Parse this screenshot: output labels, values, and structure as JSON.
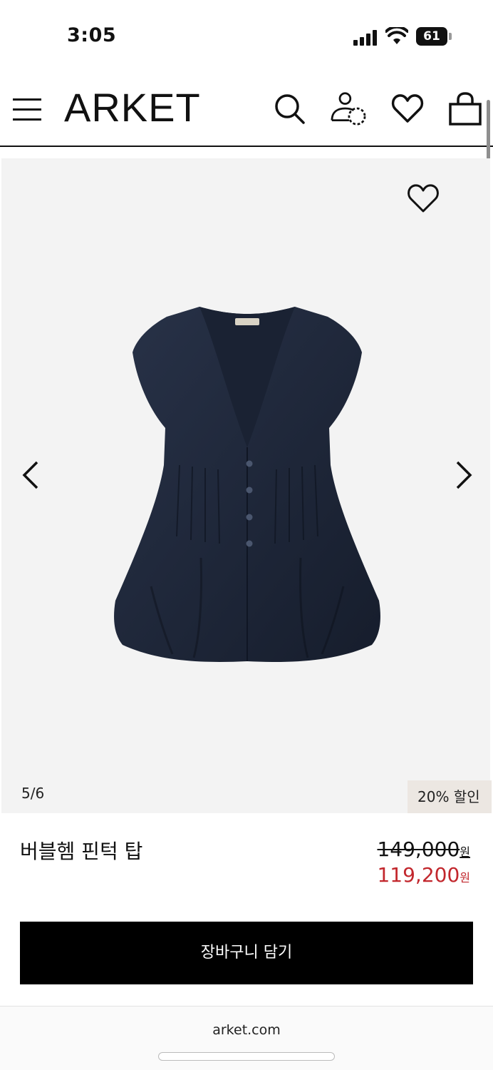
{
  "status_bar": {
    "time": "3:05",
    "battery": "61"
  },
  "header": {
    "logo": "ARKET",
    "icons": [
      "menu-icon",
      "search-icon",
      "account-icon",
      "heart-icon",
      "bag-icon"
    ]
  },
  "gallery": {
    "counter": "5/6",
    "discount_badge": "20% 할인",
    "product_color": "#1d2536"
  },
  "product": {
    "name": "버블헴 핀턱 탑",
    "original_price": "149,000",
    "sale_price": "119,200",
    "currency": "원"
  },
  "cta": {
    "add_to_cart": "장바구니 담기"
  },
  "browser": {
    "url": "arket.com"
  },
  "colors": {
    "sale": "#c2272d",
    "badge_bg": "#ece7e2",
    "gallery_bg": "#f3f3f3"
  }
}
